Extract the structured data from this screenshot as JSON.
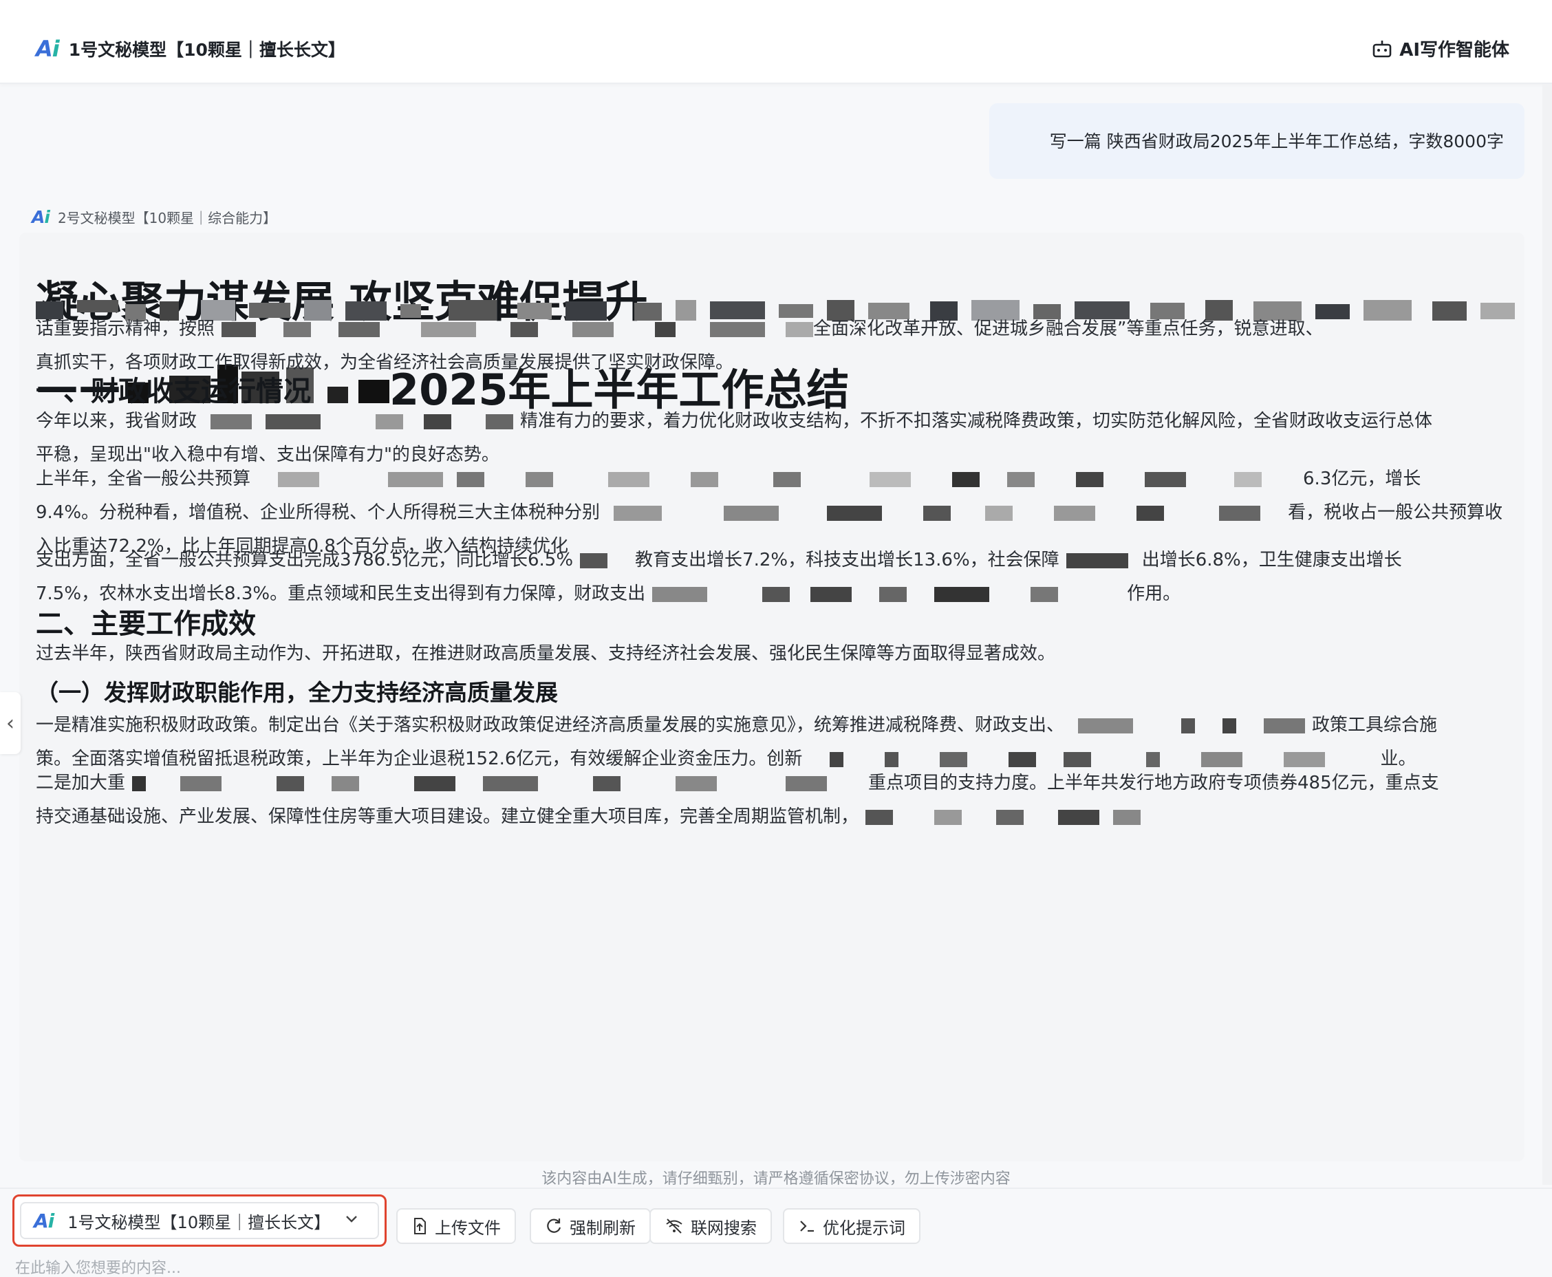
{
  "header": {
    "brand_logo": "Ai",
    "brand_title": "1号文秘模型【10颗星｜擅长长文】",
    "agent_label": "AI写作智能体"
  },
  "chat": {
    "user_message": "写一篇 陕西省财政局2025年上半年工作总结，字数8000字",
    "reply_model": "2号文秘模型【10颗星｜综合能力】"
  },
  "article": {
    "title": "凝心聚力谋发展 攻坚克难促提升",
    "subtitle_prefix": "——",
    "subtitle_suffix": "2025年上半年工作总结",
    "intro_line2_a": "话重要指示精神，按照",
    "intro_line2_b": "全面深化改革开放、促进城乡融合发展”等重点任务，锐意进取、",
    "intro_line3": "真抓实干，各项财政工作取得新成效，为全省经济社会高质量发展提供了坚实财政保障。",
    "section1_title": "一、财政收支运行情况",
    "s1p1_line1_a": "今年以来，我省财政",
    "s1p1_line1_b": "精准有力的要求，着力优化财政收支结构，不折不扣落实减税降费政策，切实防范化解风险，全省财政收支运行总体",
    "s1p1_line2": "平稳，呈现出\"收入稳中有增、支出保障有力\"的良好态势。",
    "s1p2_line1_a": "上半年，全省一般公共预算",
    "s1p2_line1_b": "6.3亿元，增长",
    "s1p2_line2_a": "9.4%。分税种看，增值税、企业所得税、个人所得税三大主体税种分别",
    "s1p2_line2_b": "看，税收占一般公共预算收",
    "s1p2_line3": "入比重达72.2%，比上年同期提高0.8个百分点，收入结构持续优化",
    "s1p3_line1_a": "支出方面，全省一般公共预算支出完成3786.5亿元，同比增长6.5%",
    "s1p3_line1_b": "教育支出增长7.2%，科技支出增长13.6%，社会保障",
    "s1p3_line1_c": "出增长6.8%，卫生健康支出增长",
    "s1p3_line2_a": "7.5%，农林水支出增长8.3%。重点领域和民生支出得到有力保障，财政支出",
    "s1p3_line2_b": "作用。",
    "section2_title": "二、主要工作成效",
    "s2p1": "过去半年，陕西省财政局主动作为、开拓进取，在推进财政高质量发展、支持经济社会发展、强化民生保障等方面取得显著成效。",
    "sub1_title": "（一）发挥财政职能作用，全力支持经济高质量发展",
    "sub1p1_line1_a": "一是精准实施积极财政政策。制定出台《关于落实积极财政政策促进经济高质量发展的实施意见》，统筹推进减税降费、财政支出、",
    "sub1p1_line1_b": "政策工具综合施",
    "sub1p1_line2_a": "策。全面落实增值税留抵退税政策，上半年为企业退税152.6亿元，有效缓解企业资金压力。创新",
    "sub1p1_line2_b": "业。",
    "sub1p2_line1_a": "二是加大重",
    "sub1p2_line1_b": "重点项目的支持力度。上半年共发行地方政府专项债券485亿元，重点支",
    "sub1p2_line2": "持交通基础设施、产业发展、保障性住房等重大项目建设。建立健全重大项目库，完善全周期监管机制，"
  },
  "footer": {
    "notice": "该内容由AI生成，请仔细甄别，请严格遵循保密协议，勿上传涉密内容",
    "model_select_label": "1号文秘模型【10颗星｜擅长长文】",
    "buttons": {
      "upload": "上传文件",
      "refresh": "强制刷新",
      "web_search": "联网搜索",
      "optimize_prompt": "优化提示词"
    },
    "input_placeholder": "在此输入您想要的内容..."
  },
  "colors": {
    "accent_blue": "#3a6fd8",
    "accent_teal": "#27b3a6",
    "highlight_red": "#e0442f",
    "bubble_bg": "#eef3fb"
  }
}
